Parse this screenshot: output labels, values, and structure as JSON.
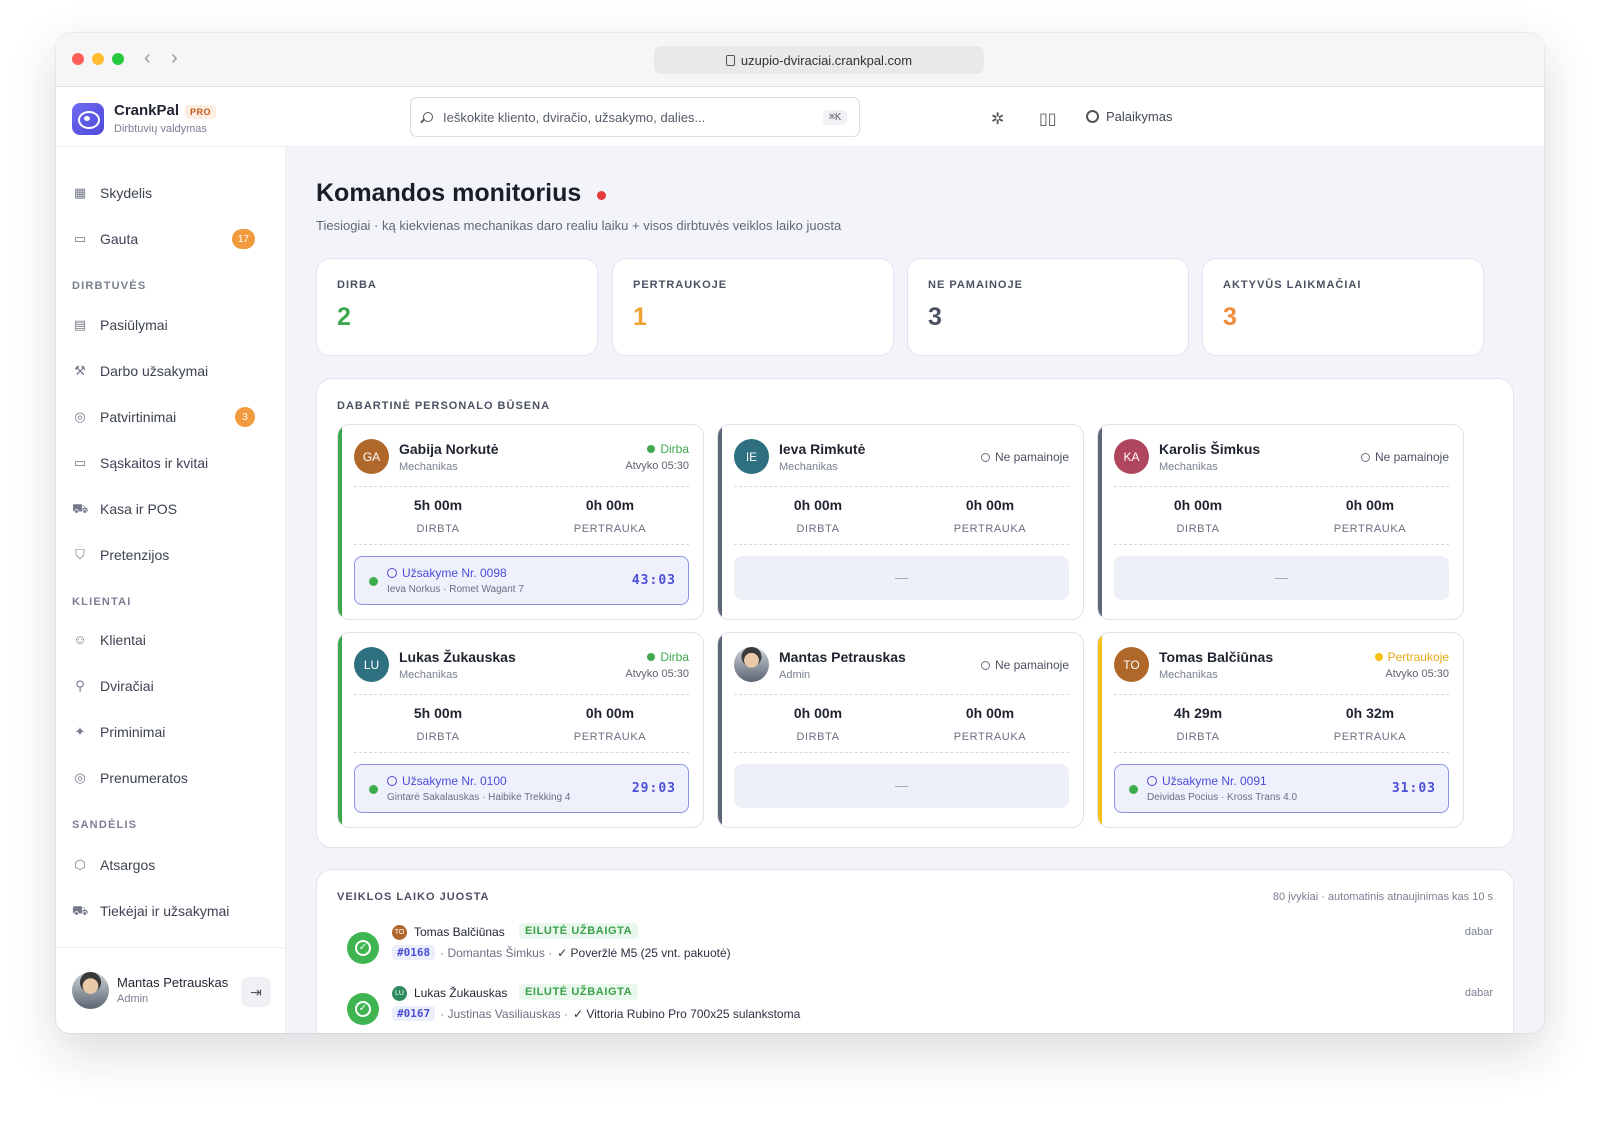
{
  "browser": {
    "url": "uzupio-dviraciai.crankpal.com"
  },
  "brand": {
    "name": "CrankPal",
    "badge": "PRO",
    "subtitle": "Dirbtuvių valdymas"
  },
  "search": {
    "placeholder": "Ieškokite kliento, dviračio, užsakymo, dalies...",
    "shortcut": "⌘K"
  },
  "header": {
    "support_label": "Palaikymas"
  },
  "sidebar": {
    "top": [
      {
        "label": "Skydelis",
        "icon": "grid-icon"
      },
      {
        "label": "Gauta",
        "icon": "inbox-icon",
        "badge": "17"
      }
    ],
    "sections": [
      {
        "title": "DIRBTUVĖS",
        "items": [
          {
            "label": "Pasiūlymai",
            "icon": "document-icon"
          },
          {
            "label": "Darbo užsakymai",
            "icon": "wrench-icon"
          },
          {
            "label": "Patvirtinimai",
            "icon": "check-circle-icon",
            "badge": "3"
          },
          {
            "label": "Sąskaitos ir kvitai",
            "icon": "receipt-icon"
          },
          {
            "label": "Kasa ir POS",
            "icon": "cart-icon"
          },
          {
            "label": "Pretenzijos",
            "icon": "shield-icon"
          }
        ]
      },
      {
        "title": "KLIENTAI",
        "items": [
          {
            "label": "Klientai",
            "icon": "users-icon"
          },
          {
            "label": "Dviračiai",
            "icon": "bike-icon"
          },
          {
            "label": "Priminimai",
            "icon": "sparkle-icon"
          },
          {
            "label": "Prenumeratos",
            "icon": "check-circle-icon"
          }
        ]
      },
      {
        "title": "SANDĖLIS",
        "items": [
          {
            "label": "Atsargos",
            "icon": "box-icon"
          },
          {
            "label": "Tiekėjai ir užsakymai",
            "icon": "truck-icon"
          }
        ]
      }
    ],
    "user": {
      "name": "Mantas Petrauskas",
      "role": "Admin"
    }
  },
  "page": {
    "title": "Komandos monitorius",
    "subtitle": "Tiesiogiai · ką kiekvienas mechanikas daro realiu laiku + visos dirbtuvės veiklos laiko juosta"
  },
  "stats": [
    {
      "label": "DIRBA",
      "value": "2",
      "color": "#3fa84e"
    },
    {
      "label": "PERTRAUKOJE",
      "value": "1",
      "color": "#f0a22e"
    },
    {
      "label": "NE PAMAINOJE",
      "value": "3",
      "color": "#4b5162"
    },
    {
      "label": "AKTYVŪS LAIKMAČIAI",
      "value": "3",
      "color": "#f08c3a"
    }
  ],
  "staff_panel": {
    "title": "DABARTINĖ PERSONALO BŪSENA",
    "labels": {
      "worked": "DIRBTA",
      "break": "PERTRAUKA",
      "empty": "—"
    },
    "cards": [
      {
        "initials": "GA",
        "name": "Gabija Norkutė",
        "role": "Mechanikas",
        "status": "Dirba",
        "arrived": "Atvyko 05:30",
        "worked": "5h 00m",
        "break": "0h 00m",
        "job": {
          "title": "Užsakyme Nr. 0098",
          "sub": "Ieva Norkus · Romet Wagant 7",
          "time": "43:03"
        }
      },
      {
        "initials": "IE",
        "name": "Ieva Rimkutė",
        "role": "Mechanikas",
        "status": "Ne pamainoje",
        "arrived": "",
        "worked": "0h 00m",
        "break": "0h 00m"
      },
      {
        "initials": "KA",
        "name": "Karolis Šimkus",
        "role": "Mechanikas",
        "status": "Ne pamainoje",
        "arrived": "",
        "worked": "0h 00m",
        "break": "0h 00m"
      },
      {
        "initials": "LU",
        "name": "Lukas Žukauskas",
        "role": "Mechanikas",
        "status": "Dirba",
        "arrived": "Atvyko 05:30",
        "worked": "5h 00m",
        "break": "0h 00m",
        "job": {
          "title": "Užsakyme Nr. 0100",
          "sub": "Gintarė Sakalauskas · Haibike Trekking 4",
          "time": "29:03"
        }
      },
      {
        "initials": "",
        "name": "Mantas Petrauskas",
        "role": "Admin",
        "status": "Ne pamainoje",
        "arrived": "",
        "worked": "0h 00m",
        "break": "0h 00m"
      },
      {
        "initials": "TO",
        "name": "Tomas Balčiūnas",
        "role": "Mechanikas",
        "status": "Pertraukoje",
        "arrived": "Atvyko 05:30",
        "worked": "4h 29m",
        "break": "0h 32m",
        "job": {
          "title": "Užsakyme Nr. 0091",
          "sub": "Deividas Pocius · Kross Trans 4.0",
          "time": "31:03"
        }
      }
    ]
  },
  "timeline": {
    "title": "VEIKLOS LAIKO JUOSTA",
    "meta": "80 įvykiai · automatinis atnaujinimas kas 10 s",
    "events": [
      {
        "initials": "TO",
        "name": "Tomas Balčiūnas",
        "badge": "EILUTĖ UŽBAIGTA",
        "order": "#0168",
        "customer": "· Domantas Šimkus ·",
        "item": "✓ Poveržlė M5 (25 vnt. pakuotė)",
        "time": "dabar"
      },
      {
        "initials": "LU",
        "name": "Lukas Žukauskas",
        "badge": "EILUTĖ UŽBAIGTA",
        "order": "#0167",
        "customer": "· Justinas Vasiliauskas ·",
        "item": "✓ Vittoria Rubino Pro 700x25 sulankstoma",
        "time": "dabar"
      }
    ]
  },
  "colors": {
    "working": "#3fa84e",
    "break": "#f5c117",
    "off": "#5f6678",
    "accent": "#4b4ed6"
  }
}
